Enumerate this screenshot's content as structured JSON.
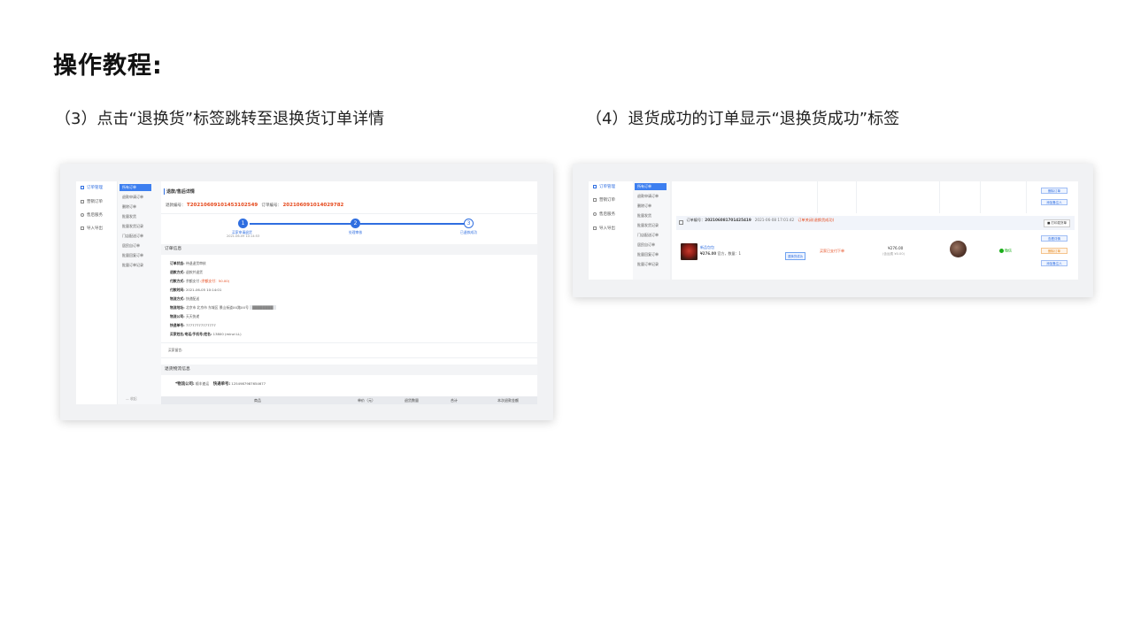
{
  "slide": {
    "title": "操作教程:",
    "step3_caption": "（3）点击“退换货”标签跳转至退换货订单详情",
    "step4_caption": "（4）退货成功的订单显示“退换货成功”标签"
  },
  "colors": {
    "accent": "#2f6ee0",
    "highlight": "#e5481b",
    "success": "#1aad19"
  },
  "left_shot": {
    "nav_main": [
      {
        "icon": "orders-icon",
        "label": "订单管理"
      },
      {
        "icon": "marketing-icon",
        "label": "营销订单"
      },
      {
        "icon": "aftersale-icon",
        "label": "售后服务"
      },
      {
        "icon": "import-icon",
        "label": "导入导出"
      }
    ],
    "nav_sub": [
      "所有订单",
      "退款申请订单",
      "删除订单",
      "批量发货",
      "批量发货记录",
      "门店配送订单",
      "居民自订单",
      "批量回复订单",
      "批量订单记录"
    ],
    "collapse_label": "收起",
    "panel_title": "退款/售后详情",
    "refund_no_label": "退款编号：",
    "refund_no": "T202106091014531025​49",
    "order_no_label": "订单编号：",
    "order_no": "20210609101402​9782",
    "steps": [
      {
        "num": "1",
        "label": "买家申请退货",
        "time": "2021-06-09 10:14:53"
      },
      {
        "num": "2",
        "label": "处理审核"
      },
      {
        "num": "3",
        "label": "已退款成功"
      }
    ],
    "info_section": "订单信息",
    "info_rows": [
      {
        "label": "订单状态:",
        "value": "待退退货审核"
      },
      {
        "label": "退款方式:",
        "value": "退款并退货"
      },
      {
        "label": "付款方式:",
        "value": "余额支付",
        "extra": "(余额支付：50.00)"
      },
      {
        "label": "付款时间:",
        "value": "2021-06-05 10:14:01"
      },
      {
        "label": "物流方式:",
        "value": "快递配送"
      },
      {
        "label": "物流地址:",
        "value": "北京市 北京市 东城区 景山街道XX路XX号"
      },
      {
        "label": "物流公司:",
        "value": "天天快递"
      },
      {
        "label": "快递单号:",
        "value": "77777777777777"
      },
      {
        "label": "买家姓名/电话/手机号/姓名:",
        "value": "13800 (minzi LL)"
      }
    ],
    "remark": "买家留言:",
    "logistics_section": "退货物流信息",
    "logistics_company_label": "*物流公司:",
    "logistics_company": "顺丰速运",
    "tracking_label": "快递单号:",
    "tracking_no": "1254987987654677",
    "table_headers": [
      "商品",
      "单价（元）",
      "退货数量",
      "合计",
      "本次退款金额"
    ]
  },
  "right_shot": {
    "nav_main": [
      {
        "icon": "orders-icon",
        "label": "订单管理"
      },
      {
        "icon": "marketing-icon",
        "label": "营销订单"
      },
      {
        "icon": "aftersale-icon",
        "label": "售后服务"
      },
      {
        "icon": "import-icon",
        "label": "导入导出"
      }
    ],
    "nav_sub": [
      "所有订单",
      "退款申请订单",
      "删除订单",
      "批量发货",
      "批量发货记录",
      "门店配送订单",
      "居民自订单",
      "批量回复订单",
      "批量订单记录"
    ],
    "top_buttons": [
      "删除订单",
      "添加备注人"
    ],
    "order_bar": {
      "label": "订单编号：",
      "order_no": "202106081701425419",
      "time": "2021-06-08 17:01:42",
      "status": "订单关闭(退换货成功)",
      "print_label": "打印发货单"
    },
    "product": {
      "name": "新品包包",
      "price": "¥276.00",
      "spec": "官方，数量：1",
      "badge": "退换货成功",
      "status": "买家已支付下单",
      "total": "¥276.00",
      "total_note": "(含运费 ¥0.00)",
      "pay_label": "微信"
    },
    "row_buttons": [
      "查看详情",
      "删除订单",
      "添加备注人"
    ]
  }
}
